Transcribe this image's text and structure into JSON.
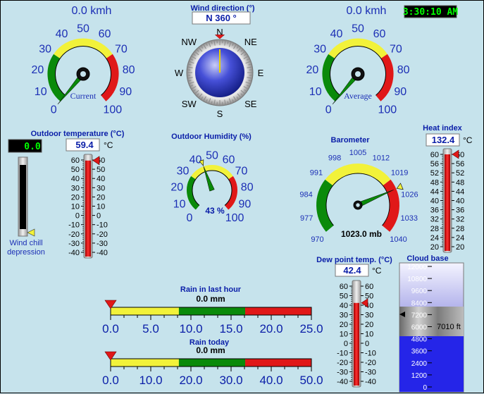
{
  "clock": {
    "time": "3:30:10 AM"
  },
  "wind_current": {
    "value_text": "0.0 kmh",
    "caption": "Current",
    "ticks": [
      "0",
      "10",
      "20",
      "30",
      "40",
      "50",
      "60",
      "70",
      "80",
      "90",
      "100"
    ],
    "value": 0
  },
  "wind_average": {
    "value_text": "0.0 kmh",
    "caption": "Average",
    "ticks": [
      "0",
      "10",
      "20",
      "30",
      "40",
      "50",
      "60",
      "70",
      "80",
      "90",
      "100"
    ],
    "value": 0
  },
  "wind_direction": {
    "title": "Wind direction (°)",
    "value_text": "N  360 °",
    "value": 360,
    "points": [
      "N",
      "NE",
      "E",
      "SE",
      "S",
      "SW",
      "W",
      "NW"
    ]
  },
  "outdoor_temp": {
    "title": "Outdoor temperature (°C)",
    "value_text": "59.4",
    "unit": "°C",
    "value": 59.4,
    "ticks": [
      "60",
      "50",
      "40",
      "30",
      "20",
      "10",
      "0",
      "-10",
      "-20",
      "-30",
      "-40"
    ]
  },
  "wind_chill": {
    "value_text": "0.0",
    "label_line1": "Wind chill",
    "label_line2": "depression",
    "value": 0
  },
  "humidity": {
    "title": "Outdoor Humidity (%)",
    "value_text": "43 %",
    "value": 43,
    "ticks": [
      "0",
      "10",
      "20",
      "30",
      "40",
      "50",
      "60",
      "70",
      "80",
      "90",
      "100"
    ]
  },
  "barometer": {
    "title": "Barometer",
    "value_text": "1023.0 mb",
    "value": 1023,
    "ticks": [
      "970",
      "977",
      "984",
      "991",
      "998",
      "1005",
      "1012",
      "1019",
      "1026",
      "1033",
      "1040"
    ]
  },
  "heat_index": {
    "title": "Heat index",
    "value_text": "132.4",
    "unit": "°C",
    "value": 60,
    "ticks": [
      "60",
      "56",
      "52",
      "48",
      "44",
      "40",
      "36",
      "32",
      "28",
      "24",
      "20"
    ]
  },
  "dew_point": {
    "title": "Dew point temp. (°C)",
    "value_text": "42.4",
    "unit": "°C",
    "value": 42.4,
    "ticks": [
      "60",
      "50",
      "40",
      "30",
      "20",
      "10",
      "0",
      "-10",
      "-20",
      "-30",
      "-40"
    ]
  },
  "cloud_base": {
    "title": "Cloud base",
    "value_text": "7010 ft",
    "value": 7010,
    "ticks": [
      "12000",
      "10800",
      "9600",
      "8400",
      "7200",
      "6000",
      "4800",
      "3600",
      "2400",
      "1200",
      "0"
    ]
  },
  "rain_hour": {
    "title": "Rain in last hour",
    "value_text": "0.0 mm",
    "value": 0,
    "ticks": [
      "0.0",
      "5.0",
      "10.0",
      "15.0",
      "20.0",
      "25.0"
    ]
  },
  "rain_today": {
    "title": "Rain today",
    "value_text": "0.0 mm",
    "value": 0,
    "ticks": [
      "0.0",
      "10.0",
      "20.0",
      "30.0",
      "40.0",
      "50.0"
    ]
  },
  "colors": {
    "background": "#c6e3ec",
    "label_blue": "#1c2fb5",
    "title_blue": "#0a1ea8",
    "green": "#0a8a0a",
    "yellow": "#f2f23a",
    "red": "#e01818",
    "clock_green": "#00ff00"
  }
}
